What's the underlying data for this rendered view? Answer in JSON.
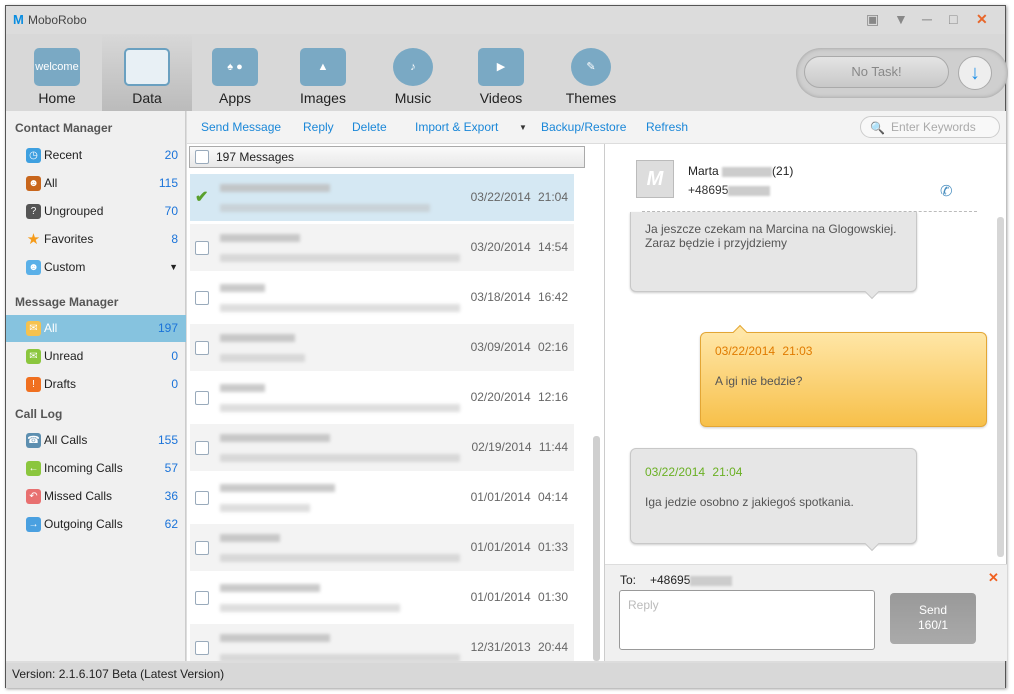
{
  "app": {
    "title": "MoboRobo",
    "logo_letter": "M"
  },
  "window_controls": [
    "feedback-icon",
    "menu-icon",
    "minimize-icon",
    "maximize-icon",
    "close-icon"
  ],
  "nav": [
    {
      "label": "Home",
      "icon": "welcome"
    },
    {
      "label": "Data"
    },
    {
      "label": "Apps"
    },
    {
      "label": "Images"
    },
    {
      "label": "Music"
    },
    {
      "label": "Videos"
    },
    {
      "label": "Themes"
    }
  ],
  "nav_active": "Data",
  "task": {
    "label": "No Task!"
  },
  "toolbar": {
    "send": "Send Message",
    "reply": "Reply",
    "delete": "Delete",
    "import_export": "Import & Export",
    "backup": "Backup/Restore",
    "refresh": "Refresh",
    "search_placeholder": "Enter Keywords"
  },
  "sidebar": {
    "contact_header": "Contact Manager",
    "contacts": [
      {
        "label": "Recent",
        "count": "20"
      },
      {
        "label": "All",
        "count": "115"
      },
      {
        "label": "Ungrouped",
        "count": "70"
      },
      {
        "label": "Favorites",
        "count": "8"
      },
      {
        "label": "Custom",
        "count": ""
      }
    ],
    "message_header": "Message Manager",
    "messages": [
      {
        "label": "All",
        "count": "197"
      },
      {
        "label": "Unread",
        "count": "0"
      },
      {
        "label": "Drafts",
        "count": "0"
      }
    ],
    "call_header": "Call Log",
    "calls": [
      {
        "label": "All Calls",
        "count": "155"
      },
      {
        "label": "Incoming Calls",
        "count": "57"
      },
      {
        "label": "Missed Calls",
        "count": "36"
      },
      {
        "label": "Outgoing Calls",
        "count": "62"
      }
    ]
  },
  "list": {
    "header": "197 Messages",
    "rows": [
      {
        "date": "03/22/2014  21:04",
        "checked": true
      },
      {
        "date": "03/20/2014  14:54"
      },
      {
        "date": "03/18/2014  16:42"
      },
      {
        "date": "03/09/2014  02:16"
      },
      {
        "date": "02/20/2014  12:16"
      },
      {
        "date": "02/19/2014  11:44"
      },
      {
        "date": "01/01/2014  04:14"
      },
      {
        "date": "01/01/2014  01:33"
      },
      {
        "date": "01/01/2014  01:30"
      },
      {
        "date": "12/31/2013  20:44"
      }
    ]
  },
  "conversation": {
    "contact_name": "Marta",
    "contact_suffix": "(21)",
    "contact_phone": "+48695",
    "messages": [
      {
        "date": "",
        "text": "Ja jeszcze czekam na Marcina na Glogowskiej. Zaraz będzie i przyjdziemy",
        "type": "incoming"
      },
      {
        "date": "03/22/2014  21:03",
        "text": "A igi nie bedzie?",
        "type": "outgoing"
      },
      {
        "date": "03/22/2014  21:04",
        "text": "Iga jedzie osobno z jakiegoś spotkania.",
        "type": "incoming"
      }
    ]
  },
  "compose": {
    "to_label": "To:",
    "to_value": "+48695",
    "placeholder": "Reply",
    "send": "Send",
    "counter": "160/1"
  },
  "status": {
    "version": "Version: 2.1.6.107 Beta  (Latest Version)"
  },
  "colors": {
    "accent": "#1a87d8",
    "selected": "#86c3df",
    "outgoing_date": "#e07b00",
    "incoming_date": "#6ab023"
  }
}
